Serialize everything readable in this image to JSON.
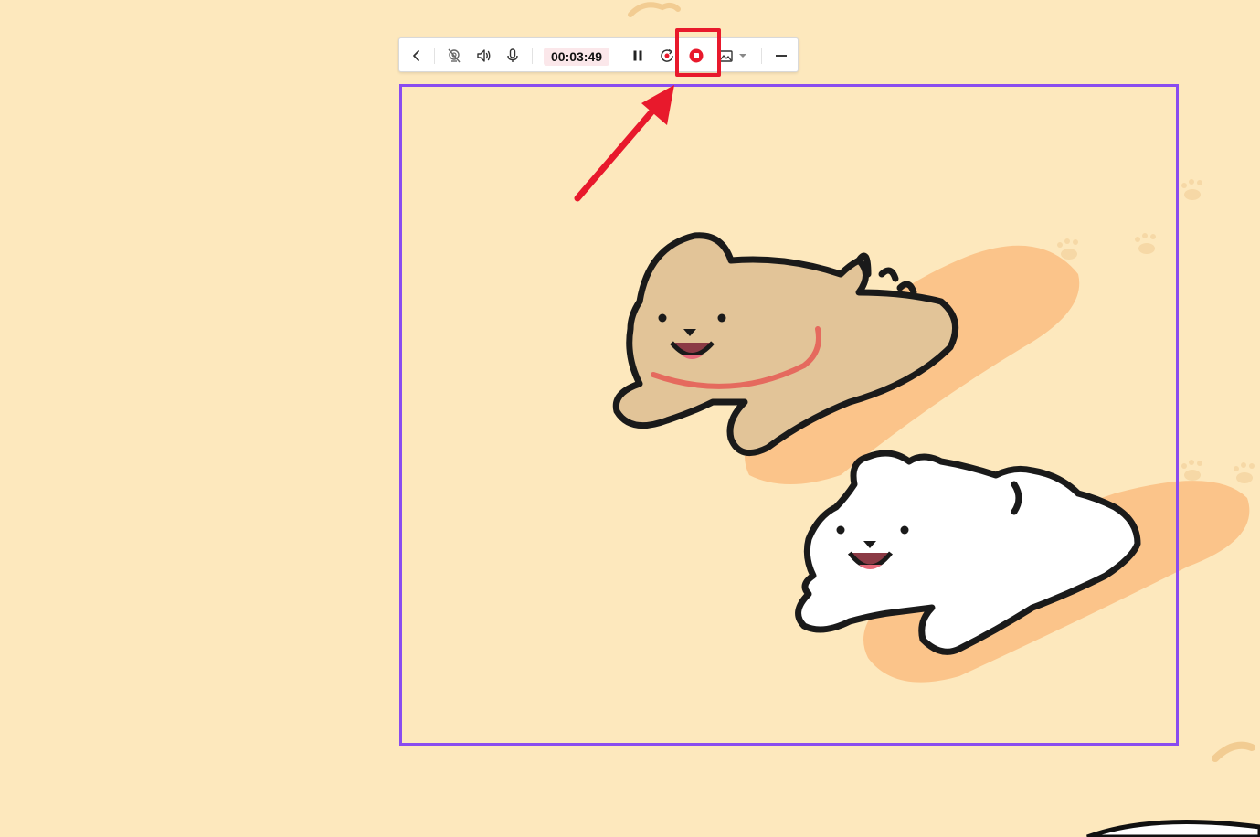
{
  "toolbar": {
    "timer": "00:03:49",
    "buttons": [
      {
        "name": "back",
        "icon": "chevron-left-icon"
      },
      {
        "name": "webcam-off",
        "icon": "webcam-off-icon"
      },
      {
        "name": "system-audio",
        "icon": "speaker-icon"
      },
      {
        "name": "microphone",
        "icon": "microphone-icon"
      },
      {
        "name": "pause",
        "icon": "pause-icon"
      },
      {
        "name": "restart",
        "icon": "restart-icon"
      },
      {
        "name": "stop",
        "icon": "stop-icon"
      },
      {
        "name": "screenshot",
        "icon": "image-icon"
      },
      {
        "name": "screenshot-options",
        "icon": "caret-down-icon"
      },
      {
        "name": "minimize",
        "icon": "minimize-icon"
      }
    ]
  },
  "colors": {
    "background": "#fde8bd",
    "toolbar_bg": "#ffffff",
    "timer_bg": "#fbe7ea",
    "stop_red": "#e8192c",
    "highlight": "#e8192c",
    "capture_border": "#8a4cf0"
  },
  "annotations": {
    "highlight_target": "stop-button",
    "arrow_icon": "red-arrow-icon"
  }
}
